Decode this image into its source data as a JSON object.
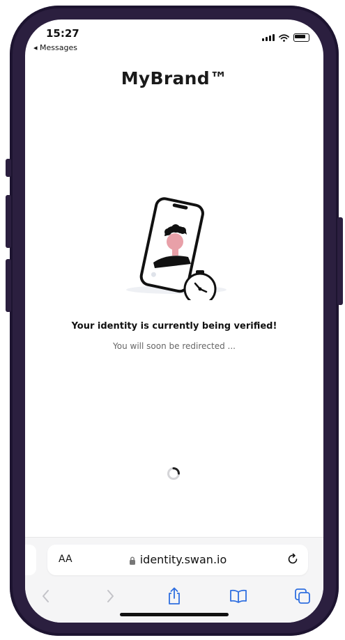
{
  "status": {
    "time": "15:27",
    "back_label": "◂ Messages"
  },
  "brand": {
    "name": "MyBrand™"
  },
  "verification": {
    "title": "Your identity is currently being verified!",
    "subtitle": "You will soon be redirected ..."
  },
  "browser": {
    "text_size_label": "AA",
    "url": "identity.swan.io"
  },
  "colors": {
    "frame": "#2b1f3f",
    "illustration_accent": "#e8a0a8"
  },
  "icons": [
    "signal-icon",
    "wifi-icon",
    "battery-icon",
    "lock-icon",
    "reload-icon",
    "back-icon",
    "forward-icon",
    "share-icon",
    "bookmarks-icon",
    "tabs-icon"
  ]
}
